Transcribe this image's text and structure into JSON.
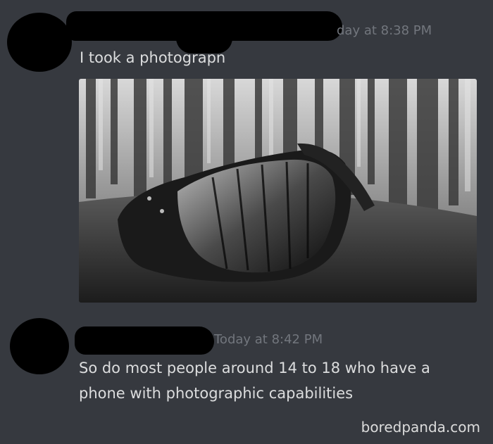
{
  "messages": [
    {
      "timestamp": "day at 8:38 PM",
      "text": "I took a photograpn",
      "attachment": {
        "type": "image",
        "icon": "sunglasses-photo"
      }
    },
    {
      "timestamp": "Today at 8:42 PM",
      "text_line1": "So do most people around 14 to 18 who have a",
      "text_line2": "phone with photographic capabilities"
    }
  ],
  "watermark": "boredpanda.com",
  "colors": {
    "background": "#36393f",
    "text": "#dcddde",
    "timestamp": "#72767d",
    "redaction": "#000000"
  }
}
